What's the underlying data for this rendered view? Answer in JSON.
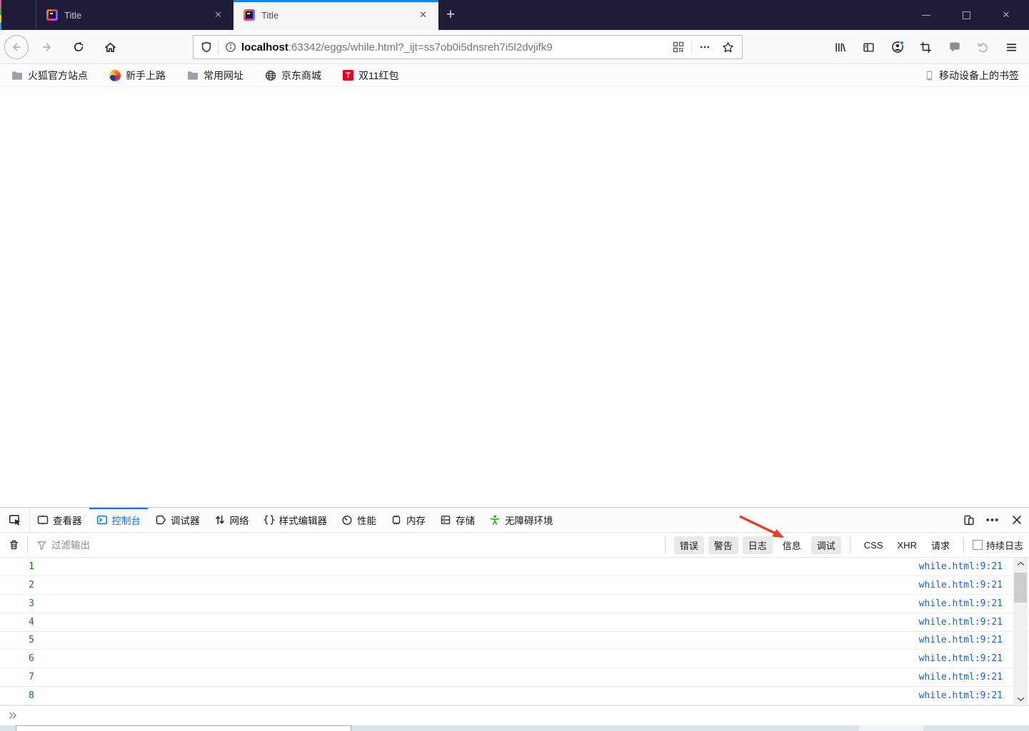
{
  "window": {
    "tabs": [
      {
        "title": "Title",
        "active": false
      },
      {
        "title": "Title",
        "active": true
      }
    ],
    "new_tab_glyph": "+",
    "close_glyph": "✕"
  },
  "navbar": {
    "url": {
      "host": "localhost",
      "rest": ":63342/eggs/while.html?_ijt=ss7ob0i5dnsreh7i5l2dvjifk9"
    }
  },
  "bookmarks_bar": {
    "items": [
      {
        "label": "火狐官方站点",
        "icon": "folder-icon"
      },
      {
        "label": "新手上路",
        "icon": "firefox-icon"
      },
      {
        "label": "常用网址",
        "icon": "folder-icon"
      },
      {
        "label": "京东商城",
        "icon": "globe-icon"
      },
      {
        "label": "双11红包",
        "icon": "tmall-icon"
      }
    ],
    "tmall_glyph": "T",
    "mobile_bookmarks_label": "移动设备上的书签"
  },
  "devtools": {
    "tabs": [
      {
        "label": "查看器",
        "active": false
      },
      {
        "label": "控制台",
        "active": true
      },
      {
        "label": "调试器",
        "active": false
      },
      {
        "label": "网络",
        "active": false
      },
      {
        "label": "样式编辑器",
        "active": false
      },
      {
        "label": "性能",
        "active": false
      },
      {
        "label": "内存",
        "active": false
      },
      {
        "label": "存储",
        "active": false
      },
      {
        "label": "无障碍环境",
        "active": false
      }
    ],
    "filter_bar": {
      "placeholder": "过滤输出",
      "level_toggles": [
        {
          "label": "错误",
          "active": true
        },
        {
          "label": "警告",
          "active": true
        },
        {
          "label": "日志",
          "active": true
        },
        {
          "label": "信息",
          "active": false
        },
        {
          "label": "调试",
          "active": true
        }
      ],
      "category_filters": [
        "CSS",
        "XHR",
        "请求"
      ],
      "persist_label": "持续日志",
      "persist_checked": false
    },
    "console_rows": [
      {
        "value": "1",
        "source": "while.html:9:21"
      },
      {
        "value": "2",
        "source": "while.html:9:21"
      },
      {
        "value": "3",
        "source": "while.html:9:21"
      },
      {
        "value": "4",
        "source": "while.html:9:21"
      },
      {
        "value": "5",
        "source": "while.html:9:21"
      },
      {
        "value": "6",
        "source": "while.html:9:21"
      },
      {
        "value": "7",
        "source": "while.html:9:21"
      },
      {
        "value": "8",
        "source": "while.html:9:21"
      }
    ],
    "input_prompt": "»"
  },
  "annotation": {
    "type": "arrow",
    "color": "#e93a24",
    "points_at": "日志"
  }
}
